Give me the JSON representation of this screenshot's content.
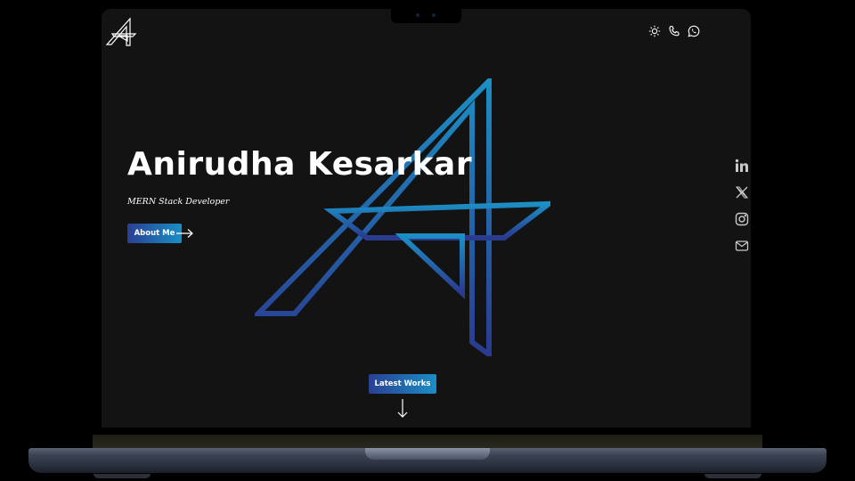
{
  "hero": {
    "name": "Anirudha Kesarkar",
    "role": "MERN Stack Developer",
    "about_button": "About Me",
    "works_button": "Latest Works"
  },
  "header": {
    "icons": [
      "sun-icon",
      "phone-icon",
      "whatsapp-icon"
    ]
  },
  "social": {
    "icons": [
      "linkedin-icon",
      "x-icon",
      "instagram-icon",
      "mail-icon"
    ]
  },
  "colors": {
    "background": "#131313",
    "accent_start": "#2a3f94",
    "accent_end": "#1a8ec4"
  }
}
